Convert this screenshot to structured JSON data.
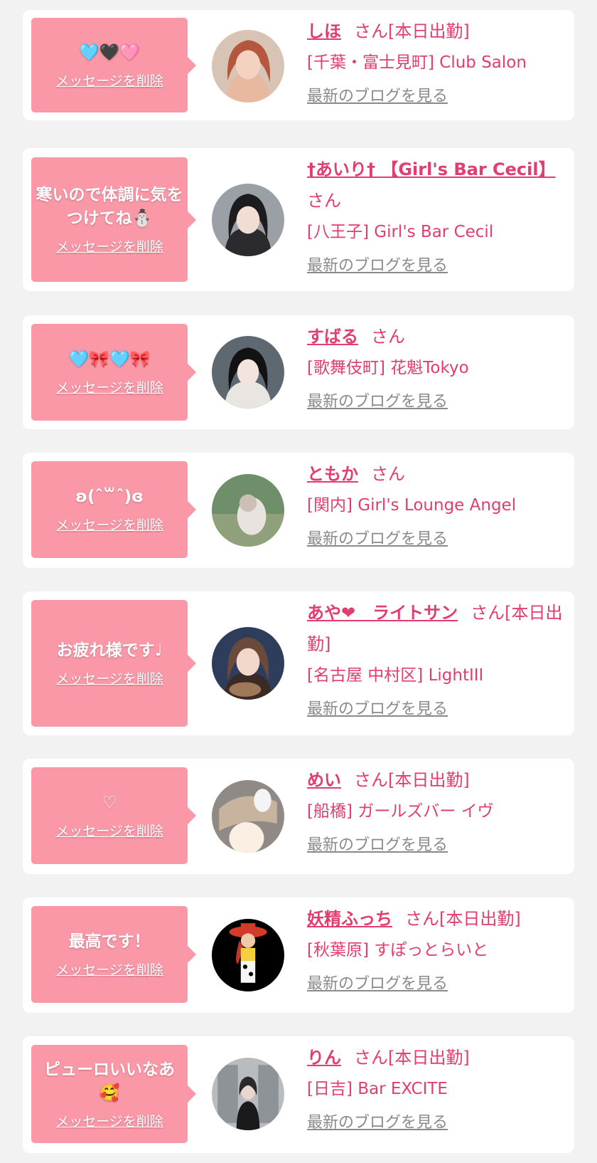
{
  "common": {
    "delete_label": "メッセージを削除",
    "blog_label": "最新のブログを見る"
  },
  "theme": {
    "background": "#f2f2f2",
    "bubble": "#fb98a8",
    "accent": "#e23d6f",
    "link_gray": "#8a8a8a"
  },
  "items": [
    {
      "message": "🩵🖤🩷",
      "name": "しほ",
      "suffix": "さん[本日出勤]",
      "shop": "[千葉・富士見町] Club Salon",
      "avatar": "woman-photo"
    },
    {
      "message": "寒いので体調に気をつけてね⛄",
      "name": "†あいり† 【Girl's Bar Cecil】",
      "suffix": "さん",
      "shop": "[八王子] Girl's Bar Cecil",
      "avatar": "woman-photo"
    },
    {
      "message": "🩵🎀🩵🎀",
      "name": "すばる",
      "suffix": "さん",
      "shop": "[歌舞伎町] 花魁Tokyo",
      "avatar": "woman-photo"
    },
    {
      "message": "ʚ(ˆ꒳ˆ)ɞ",
      "name": "ともか",
      "suffix": "さん",
      "shop": "[関内] Girl's Lounge Angel",
      "avatar": "woman-photo"
    },
    {
      "message": "お疲れ様です♩",
      "name": "あや❤　ライトサン",
      "suffix": "さん[本日出勤]",
      "shop": "[名古屋 中村区] LightIII",
      "avatar": "woman-photo"
    },
    {
      "message": "♡",
      "name": "めい",
      "suffix": "さん[本日出勤]",
      "shop": "[船橋] ガールズバー イヴ",
      "avatar": "woman-photo"
    },
    {
      "message": "最高です！",
      "name": "妖精ふっち",
      "suffix": "さん[本日出勤]",
      "shop": "[秋葉原] すぽっとらいと",
      "avatar": "cowgirl-figure"
    },
    {
      "message": "ピューロいいなあ🥰",
      "name": "りん",
      "suffix": "さん[本日出勤]",
      "shop": "[日吉] Bar EXCITE",
      "avatar": "woman-photo"
    }
  ]
}
